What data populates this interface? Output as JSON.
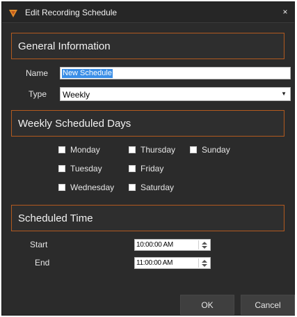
{
  "window": {
    "title": "Edit Recording Schedule",
    "close_glyph": "×",
    "icon": "app-shield-icon"
  },
  "general": {
    "heading": "General Information",
    "name_label": "Name",
    "name_value": "New Schedule",
    "type_label": "Type",
    "type_value": "Weekly"
  },
  "weekly": {
    "heading": "Weekly Scheduled Days",
    "days": [
      "Monday",
      "Tuesday",
      "Wednesday",
      "Thursday",
      "Friday",
      "Saturday",
      "Sunday"
    ]
  },
  "time": {
    "heading": "Scheduled Time",
    "start_label": "Start",
    "start_value": "10:00:00 AM",
    "end_label": "End",
    "end_value": "11:00:00 AM"
  },
  "buttons": {
    "ok": "OK",
    "cancel": "Cancel"
  },
  "colors": {
    "accent": "#b35a1f",
    "background": "#2b2b2b",
    "selection": "#3a8ee6"
  }
}
